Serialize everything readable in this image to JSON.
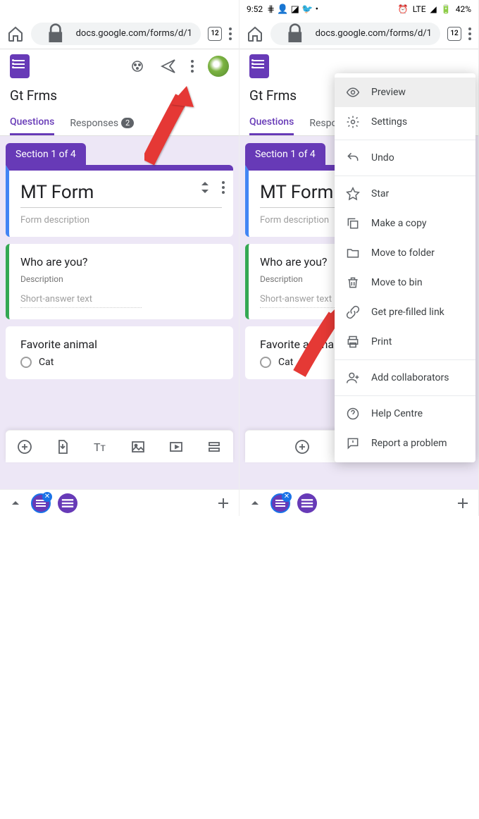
{
  "status_bar": {
    "time": "9:52",
    "network": "LTE",
    "battery": "42%"
  },
  "browser": {
    "url": "docs.google.com/forms/d/1",
    "tab_count": "12"
  },
  "form": {
    "title": "Gt Frms",
    "tabs": {
      "questions": "Questions",
      "responses": "Responses",
      "responses_count": "2"
    },
    "section_label": "Section 1 of 4",
    "title_card": {
      "title": "MT Form",
      "description": "Form description"
    },
    "q1": {
      "title": "Who are you?",
      "desc": "Description",
      "answer_hint": "Short-answer text"
    },
    "q2": {
      "title": "Favorite animal",
      "option1": "Cat"
    }
  },
  "menu": {
    "preview": "Preview",
    "settings": "Settings",
    "undo": "Undo",
    "star": "Star",
    "make_copy": "Make a copy",
    "move_folder": "Move to folder",
    "move_bin": "Move to bin",
    "prefilled": "Get pre-filled link",
    "print": "Print",
    "collaborators": "Add collaborators",
    "help": "Help Centre",
    "report": "Report a problem"
  }
}
